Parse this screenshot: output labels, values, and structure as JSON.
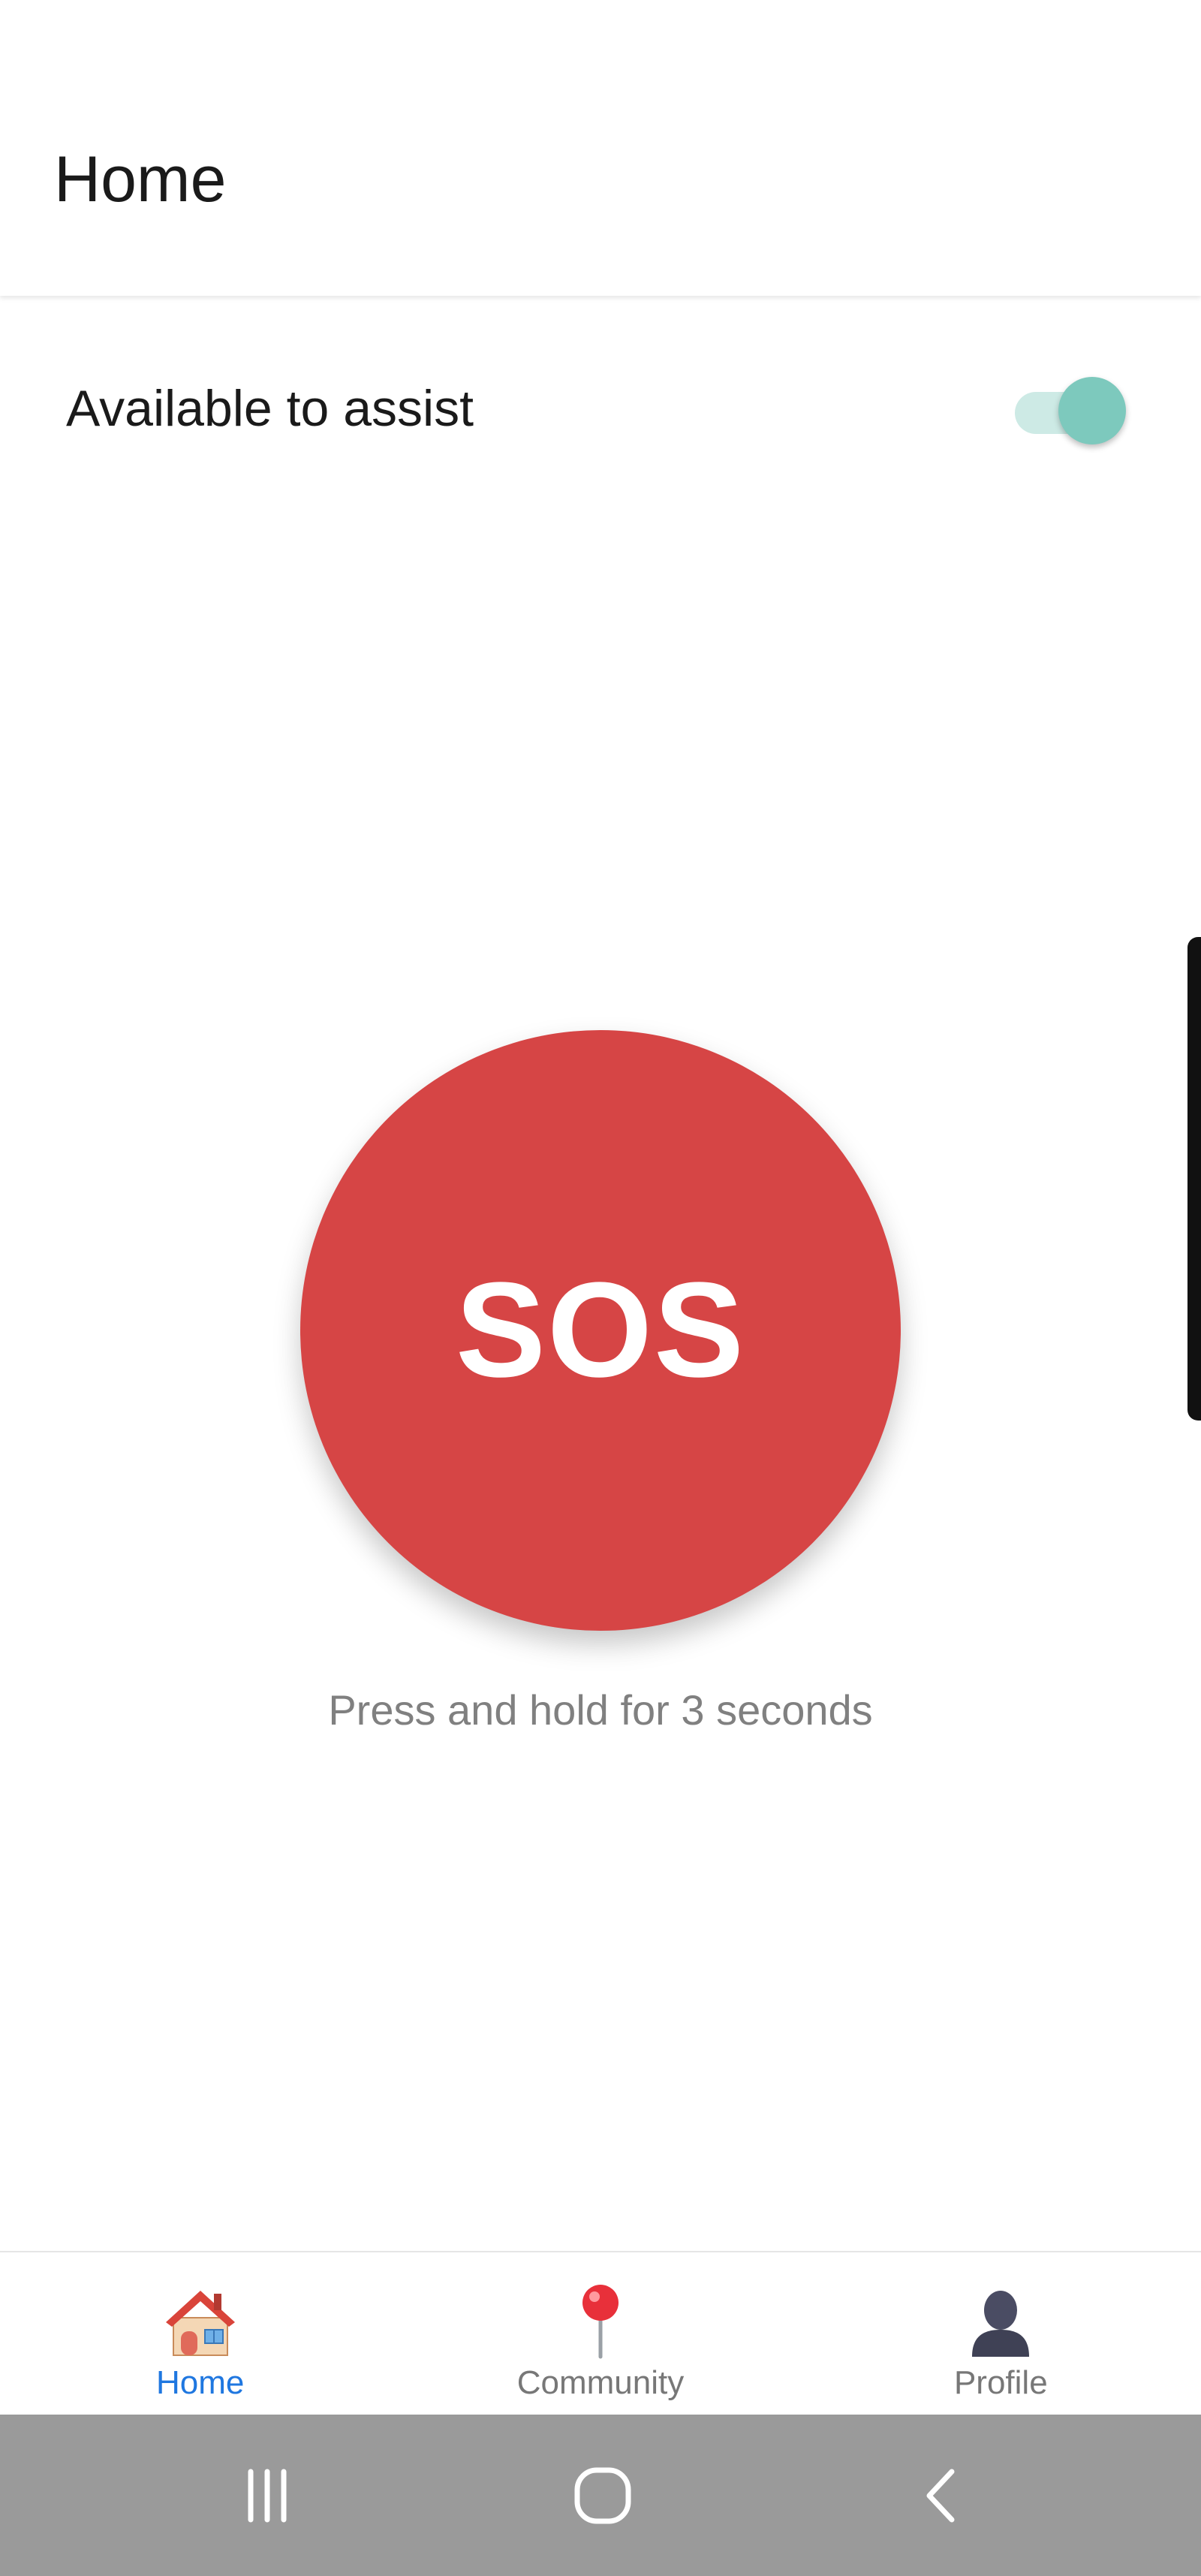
{
  "header": {
    "title": "Home"
  },
  "availability": {
    "label": "Available to assist",
    "enabled": true,
    "accent_color": "#7dc9bd"
  },
  "sos": {
    "label": "SOS",
    "hint": "Press and hold for 3 seconds",
    "color": "#d64545"
  },
  "bottom_nav": {
    "items": [
      {
        "label": "Home",
        "icon": "house-icon",
        "active": true
      },
      {
        "label": "Community",
        "icon": "map-pin-icon",
        "active": false
      },
      {
        "label": "Profile",
        "icon": "person-silhouette-icon",
        "active": false
      }
    ],
    "active_color": "#1f77e0"
  },
  "system_nav": {
    "buttons": [
      "recent-apps-icon",
      "home-circle-icon",
      "back-chevron-icon"
    ]
  }
}
